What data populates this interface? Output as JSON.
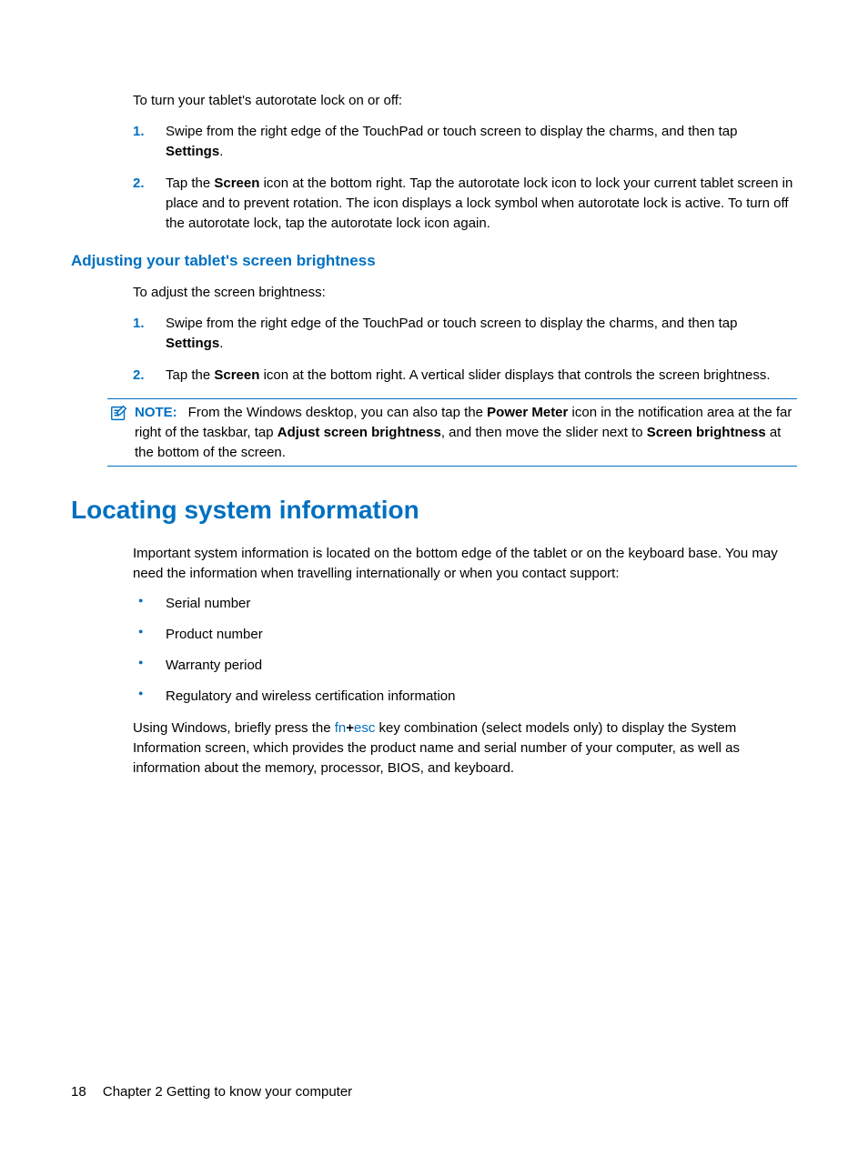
{
  "intro_autorotate": "To turn your tablet's autorotate lock on or off:",
  "autorotate_steps": [
    {
      "num": "1.",
      "prefix": "Swipe from the right edge of the TouchPad or touch screen to display the charms, and then tap ",
      "bold1": "Settings",
      "suffix": "."
    },
    {
      "num": "2.",
      "prefix": "Tap the ",
      "bold1": "Screen",
      "suffix": " icon at the bottom right. Tap the autorotate lock icon to lock your current tablet screen in place and to prevent rotation. The icon displays a lock symbol when autorotate lock is active. To turn off the autorotate lock, tap the autorotate lock icon again."
    }
  ],
  "heading_brightness": "Adjusting your tablet's screen brightness",
  "intro_brightness": "To adjust the screen brightness:",
  "brightness_steps": [
    {
      "num": "1.",
      "prefix": "Swipe from the right edge of the TouchPad or touch screen to display the charms, and then tap ",
      "bold1": "Settings",
      "suffix": "."
    },
    {
      "num": "2.",
      "prefix": "Tap the ",
      "bold1": "Screen",
      "suffix": " icon at the bottom right. A vertical slider displays that controls the screen brightness."
    }
  ],
  "note": {
    "label": "NOTE:",
    "p1": "From the Windows desktop, you can also tap the ",
    "b1": "Power Meter",
    "p2": " icon in the notification area at the far right of the taskbar, tap ",
    "b2": "Adjust screen brightness",
    "p3": ", and then move the slider next to ",
    "b3": "Screen brightness",
    "p4": " at the bottom of the screen."
  },
  "heading_locating": "Locating system information",
  "locating_para": "Important system information is located on the bottom edge of the tablet or on the keyboard base. You may need the information when travelling internationally or when you contact support:",
  "bullets": [
    "Serial number",
    "Product number",
    "Warranty period",
    "Regulatory and wireless certification information"
  ],
  "keycombo": {
    "p1": "Using Windows, briefly press the ",
    "k1": "fn",
    "plus": "+",
    "k2": "esc",
    "p2": " key combination (select models only) to display the System Information screen, which provides the product name and serial number of your computer, as well as information about the memory, processor, BIOS, and keyboard."
  },
  "footer": {
    "page": "18",
    "chapter": "Chapter 2   Getting to know your computer"
  }
}
